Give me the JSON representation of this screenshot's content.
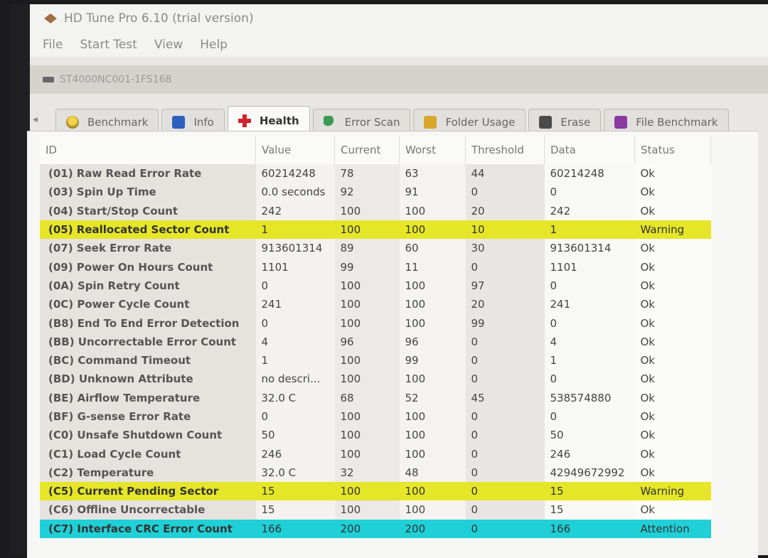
{
  "window": {
    "title": "HD Tune Pro 6.10 (trial version)"
  },
  "menu": [
    "File",
    "Start Test",
    "View",
    "Help"
  ],
  "drive": {
    "name": "ST4000NC001-1FS168"
  },
  "tabs": [
    {
      "label": "Benchmark",
      "icon": "lightbulb-icon"
    },
    {
      "label": "Info",
      "icon": "info-icon"
    },
    {
      "label": "Health",
      "icon": "health-cross-icon",
      "active": true
    },
    {
      "label": "Error Scan",
      "icon": "magnifier-icon"
    },
    {
      "label": "Folder Usage",
      "icon": "folder-icon"
    },
    {
      "label": "Erase",
      "icon": "trash-icon"
    },
    {
      "label": "File Benchmark",
      "icon": "file-icon"
    }
  ],
  "table": {
    "headers": [
      "ID",
      "Value",
      "Current",
      "Worst",
      "Threshold",
      "Data",
      "Status"
    ],
    "rows": [
      [
        "(01) Raw Read Error Rate",
        "60214248",
        "78",
        "63",
        "44",
        "60214248",
        "Ok"
      ],
      [
        "(03) Spin Up Time",
        "0.0 seconds",
        "92",
        "91",
        "0",
        "0",
        "Ok"
      ],
      [
        "(04) Start/Stop Count",
        "242",
        "100",
        "100",
        "20",
        "242",
        "Ok"
      ],
      [
        "(05) Reallocated Sector Count",
        "1",
        "100",
        "100",
        "10",
        "1",
        "Warning"
      ],
      [
        "(07) Seek Error Rate",
        "913601314",
        "89",
        "60",
        "30",
        "913601314",
        "Ok"
      ],
      [
        "(09) Power On Hours Count",
        "1101",
        "99",
        "11",
        "0",
        "1101",
        "Ok"
      ],
      [
        "(0A) Spin Retry Count",
        "0",
        "100",
        "100",
        "97",
        "0",
        "Ok"
      ],
      [
        "(0C) Power Cycle Count",
        "241",
        "100",
        "100",
        "20",
        "241",
        "Ok"
      ],
      [
        "(B8) End To End Error Detection",
        "0",
        "100",
        "100",
        "99",
        "0",
        "Ok"
      ],
      [
        "(BB) Uncorrectable Error Count",
        "4",
        "96",
        "96",
        "0",
        "4",
        "Ok"
      ],
      [
        "(BC) Command Timeout",
        "1",
        "100",
        "99",
        "0",
        "1",
        "Ok"
      ],
      [
        "(BD) Unknown Attribute",
        "no descri...",
        "100",
        "100",
        "0",
        "0",
        "Ok"
      ],
      [
        "(BE) Airflow Temperature",
        "32.0 C",
        "68",
        "52",
        "45",
        "538574880",
        "Ok"
      ],
      [
        "(BF) G-sense Error Rate",
        "0",
        "100",
        "100",
        "0",
        "0",
        "Ok"
      ],
      [
        "(C0) Unsafe Shutdown Count",
        "50",
        "100",
        "100",
        "0",
        "50",
        "Ok"
      ],
      [
        "(C1) Load Cycle Count",
        "246",
        "100",
        "100",
        "0",
        "246",
        "Ok"
      ],
      [
        "(C2) Temperature",
        "32.0 C",
        "32",
        "48",
        "0",
        "42949672992",
        "Ok"
      ],
      [
        "(C5) Current Pending Sector",
        "15",
        "100",
        "100",
        "0",
        "15",
        "Warning"
      ],
      [
        "(C6) Offline Uncorrectable",
        "15",
        "100",
        "100",
        "0",
        "15",
        "Ok"
      ],
      [
        "(C7) Interface CRC Error Count",
        "166",
        "200",
        "200",
        "0",
        "166",
        "Attention"
      ]
    ]
  },
  "colors": {
    "warning": "#e5e628",
    "attention": "#1fd0d6"
  }
}
